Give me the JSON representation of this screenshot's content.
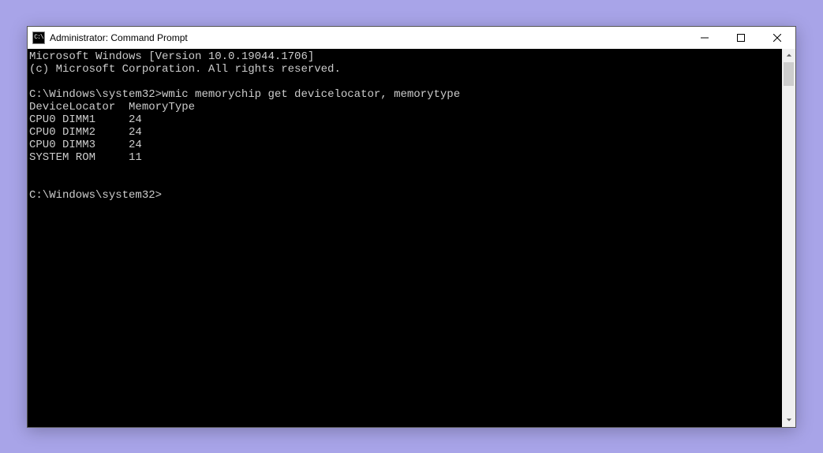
{
  "titlebar": {
    "icon_text": "C:\\",
    "title": "Administrator: Command Prompt"
  },
  "console": {
    "header_line1": "Microsoft Windows [Version 10.0.19044.1706]",
    "header_line2": "(c) Microsoft Corporation. All rights reserved.",
    "prompt1": "C:\\Windows\\system32>",
    "command1": "wmic memorychip get devicelocator, memorytype",
    "columns_header": "DeviceLocator  MemoryType",
    "rows": [
      "CPU0 DIMM1     24",
      "CPU0 DIMM2     24",
      "CPU0 DIMM3     24",
      "SYSTEM ROM     11"
    ],
    "prompt2": "C:\\Windows\\system32>"
  }
}
